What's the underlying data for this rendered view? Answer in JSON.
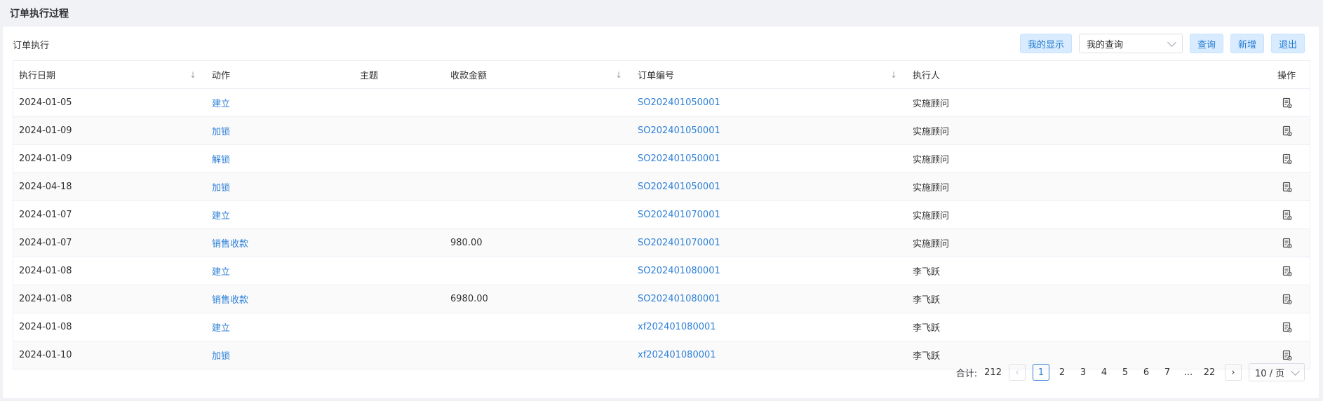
{
  "page": {
    "title": "订单执行过程"
  },
  "section": {
    "title": "订单执行"
  },
  "toolbar": {
    "my_display": "我的显示",
    "query_select": "我的查询",
    "query": "查询",
    "add": "新增",
    "exit": "退出"
  },
  "table": {
    "columns": {
      "date": "执行日期",
      "action": "动作",
      "subject": "主题",
      "amount": "收款金额",
      "order_no": "订单编号",
      "executor": "执行人",
      "ops": "操作"
    },
    "rows": [
      {
        "date": "2024-01-05",
        "action": "建立",
        "subject": "",
        "amount": "",
        "order_no": "SO202401050001",
        "executor": "实施顾问"
      },
      {
        "date": "2024-01-09",
        "action": "加锁",
        "subject": "",
        "amount": "",
        "order_no": "SO202401050001",
        "executor": "实施顾问"
      },
      {
        "date": "2024-01-09",
        "action": "解锁",
        "subject": "",
        "amount": "",
        "order_no": "SO202401050001",
        "executor": "实施顾问"
      },
      {
        "date": "2024-04-18",
        "action": "加锁",
        "subject": "",
        "amount": "",
        "order_no": "SO202401050001",
        "executor": "实施顾问"
      },
      {
        "date": "2024-01-07",
        "action": "建立",
        "subject": "",
        "amount": "",
        "order_no": "SO202401070001",
        "executor": "实施顾问"
      },
      {
        "date": "2024-01-07",
        "action": "销售收款",
        "subject": "",
        "amount": "980.00",
        "order_no": "SO202401070001",
        "executor": "实施顾问"
      },
      {
        "date": "2024-01-08",
        "action": "建立",
        "subject": "",
        "amount": "",
        "order_no": "SO202401080001",
        "executor": "李飞跃"
      },
      {
        "date": "2024-01-08",
        "action": "销售收款",
        "subject": "",
        "amount": "6980.00",
        "order_no": "SO202401080001",
        "executor": "李飞跃"
      },
      {
        "date": "2024-01-08",
        "action": "建立",
        "subject": "",
        "amount": "",
        "order_no": "xf202401080001",
        "executor": "李飞跃"
      },
      {
        "date": "2024-01-10",
        "action": "加锁",
        "subject": "",
        "amount": "",
        "order_no": "xf202401080001",
        "executor": "李飞跃"
      }
    ]
  },
  "pagination": {
    "total_label": "合计:",
    "total": "212",
    "pages": [
      "1",
      "2",
      "3",
      "4",
      "5",
      "6",
      "7",
      "...",
      "22"
    ],
    "current": "1",
    "page_size": "10 / 页"
  },
  "icons": {
    "sort": "sort-arrow-icon",
    "row_op": "document-view-icon"
  },
  "colors": {
    "link": "#2f80d8",
    "button_bg": "#d9ecff"
  }
}
